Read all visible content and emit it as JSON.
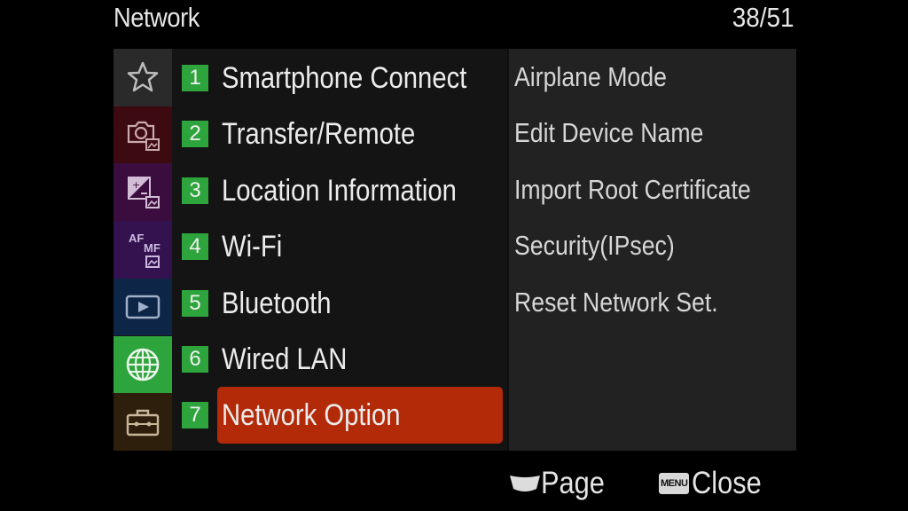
{
  "header": {
    "title": "Network",
    "page_counter": "38/51"
  },
  "tabs": [
    {
      "icon": "star-icon",
      "color": "#2a2a2a"
    },
    {
      "icon": "camera-still-icon",
      "color": "#3d0a12"
    },
    {
      "icon": "exposure-color-icon",
      "color": "#3a0d3e"
    },
    {
      "icon": "af-mf-icon",
      "color": "#33124f",
      "text_top": "AF",
      "text_bottom": "MF"
    },
    {
      "icon": "playback-icon",
      "color": "#0d2647"
    },
    {
      "icon": "globe-icon",
      "color": "#2da43c",
      "selected": true
    },
    {
      "icon": "toolbox-icon",
      "color": "#2e1e0c"
    }
  ],
  "menu_items": [
    {
      "num": "1",
      "label": "Smartphone Connect"
    },
    {
      "num": "2",
      "label": "Transfer/Remote"
    },
    {
      "num": "3",
      "label": "Location Information"
    },
    {
      "num": "4",
      "label": "Wi-Fi"
    },
    {
      "num": "5",
      "label": "Bluetooth"
    },
    {
      "num": "6",
      "label": "Wired LAN"
    },
    {
      "num": "7",
      "label": "Network Option",
      "selected": true
    }
  ],
  "sub_items": [
    "Airplane Mode",
    "Edit Device Name",
    "Import Root Certificate",
    "Security(IPsec)",
    "Reset Network Set."
  ],
  "footer": {
    "page_label": "Page",
    "menu_key": "MENU",
    "close_label": "Close"
  },
  "colors": {
    "accent_selected": "#b22a08",
    "number_badge": "#2da43c"
  }
}
